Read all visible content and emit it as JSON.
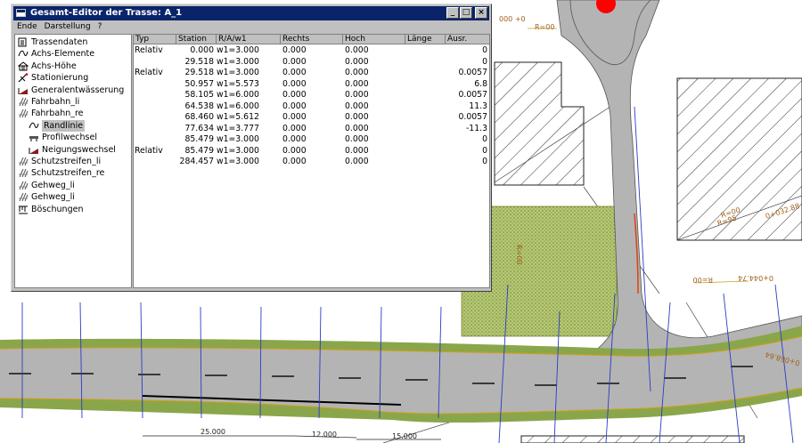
{
  "window": {
    "title": "Gesamt-Editor der Trasse: A_1",
    "buttons": {
      "minimize": "_",
      "maximize": "□",
      "close": "×"
    },
    "menu": [
      "Ende",
      "Darstellung",
      "?"
    ]
  },
  "tree": {
    "items": [
      {
        "label": "Trassendaten",
        "icon": "document-icon",
        "indent": 0
      },
      {
        "label": "Achs-Elemente",
        "icon": "curve-icon",
        "indent": 0
      },
      {
        "label": "Achs-Höhe",
        "icon": "house-icon",
        "indent": 0
      },
      {
        "label": "Stationierung",
        "icon": "pin-icon",
        "indent": 0
      },
      {
        "label": "Generalentwässerung",
        "icon": "slope-icon",
        "indent": 0
      },
      {
        "label": "Fahrbahn_li",
        "icon": "lanes-icon",
        "indent": 0
      },
      {
        "label": "Fahrbahn_re",
        "icon": "lanes-icon",
        "indent": 0
      },
      {
        "label": "Randlinie",
        "icon": "curve-icon",
        "indent": 1,
        "selected": true
      },
      {
        "label": "Profilwechsel",
        "icon": "profile-icon",
        "indent": 1
      },
      {
        "label": "Neigungswechsel",
        "icon": "slope-icon",
        "indent": 1
      },
      {
        "label": "Schutzstreifen_li",
        "icon": "lanes-icon",
        "indent": 0
      },
      {
        "label": "Schutzstreifen_re",
        "icon": "lanes-icon",
        "indent": 0
      },
      {
        "label": "Gehweg_li",
        "icon": "lanes-icon",
        "indent": 0
      },
      {
        "label": "Gehweg_li",
        "icon": "lanes-icon",
        "indent": 0
      },
      {
        "label": "Böschungen",
        "icon": "embankment-icon",
        "indent": 0
      }
    ]
  },
  "grid": {
    "columns": [
      "Typ",
      "Station",
      "R/A/w1",
      "Rechts",
      "Hoch",
      "Länge",
      "Ausr."
    ],
    "rows": [
      [
        "Relativ",
        "0.000",
        "w1=3.000",
        "0.000",
        "0.000",
        "",
        "0"
      ],
      [
        "",
        "29.518",
        "w1=3.000",
        "0.000",
        "0.000",
        "",
        "0"
      ],
      [
        "Relativ",
        "29.518",
        "w1=3.000",
        "0.000",
        "0.000",
        "",
        "0.0057"
      ],
      [
        "",
        "50.957",
        "w1=5.573",
        "0.000",
        "0.000",
        "",
        "6.8"
      ],
      [
        "",
        "58.105",
        "w1=6.000",
        "0.000",
        "0.000",
        "",
        "0.0057"
      ],
      [
        "",
        "64.538",
        "w1=6.000",
        "0.000",
        "0.000",
        "",
        "11.3"
      ],
      [
        "",
        "68.460",
        "w1=5.612",
        "0.000",
        "0.000",
        "",
        "0.0057"
      ],
      [
        "",
        "77.634",
        "w1=3.777",
        "0.000",
        "0.000",
        "",
        "-11.3"
      ],
      [
        "",
        "85.479",
        "w1=3.000",
        "0.000",
        "0.000",
        "",
        "0"
      ],
      [
        "Relativ",
        "85.479",
        "w1=3.000",
        "0.000",
        "0.000",
        "",
        "0"
      ],
      [
        "",
        "284.457",
        "w1=3.000",
        "0.000",
        "0.000",
        "",
        "0"
      ]
    ]
  },
  "drawing": {
    "labels": [
      "000 +0",
      "R=00",
      "0+032.88",
      "R=95",
      "R=00",
      "0+044.74",
      "R=00",
      "0+068.64",
      "R=00"
    ],
    "dimensions": [
      "25.000",
      "12.000",
      "15.000"
    ],
    "colors": {
      "road": "#b4b4b4",
      "verge": "#8aa64a",
      "edge": "#c8a020",
      "station_line": "#2a3cc8",
      "hatch": "#333333",
      "marker": "#ff0000"
    }
  }
}
